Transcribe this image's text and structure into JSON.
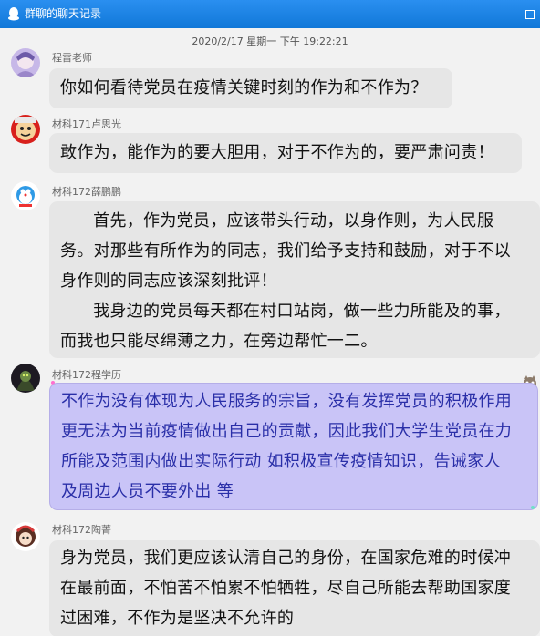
{
  "window": {
    "title": "群聊的聊天记录"
  },
  "chat": {
    "timestamp": "2020/2/17 星期一 下午 19:22:21",
    "messages": [
      {
        "sender": "程雷老师",
        "text": "你如何看待党员在疫情关键时刻的作为和不作为？"
      },
      {
        "sender": "材科171卢思光",
        "text": "敢作为，能作为的要大胆用，对于不作为的，要严肃问责！"
      },
      {
        "sender": "材科172薛鹏鹏",
        "text": "      首先，作为党员，应该带头行动，以身作则，为人民服\n务。对那些有所作为的同志，我们给予支持和鼓励，对于不以\n身作则的同志应该深刻批评！\n      我身边的党员每天都在村口站岗，做一些力所能及的事，\n而我也只能尽绵薄之力，在旁边帮忙一二。"
      },
      {
        "sender": "材科172程学历",
        "text": "不作为没有体现为人民服务的宗旨，没有发挥党员的积极作用\n更无法为当前疫情做出自己的贡献，因此我们大学生党员在力\n所能及范围内做出实际行动 如积极宣传疫情知识，告诫家人\n及周边人员不要外出 等"
      },
      {
        "sender": "材科172陶菁",
        "text": "身为党员，我们更应该认清自己的身份，在国家危难的时候冲\n在最前面，不怕苦不怕累不怕牺牲，尽自己所能去帮助国家度\n过困难，不作为是坚决不允许的"
      }
    ]
  },
  "colors": {
    "titlebar": "#1a82e2",
    "chat_background": "#f2f2f2",
    "bubble_gray": "#e6e6e6",
    "bubble_purple": "#c9c4f7",
    "purple_text": "#2a2fa8"
  },
  "icons": {
    "titlebar": "qq-penguin-icon",
    "close": "close-icon"
  }
}
